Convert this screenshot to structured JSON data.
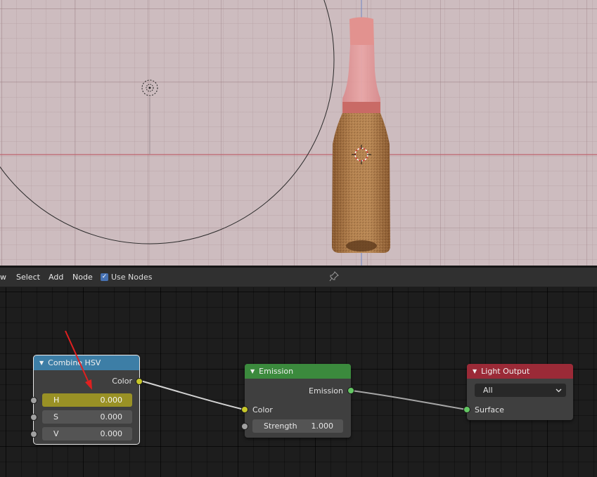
{
  "header": {
    "menu_fragment": "w",
    "menu_select": "Select",
    "menu_add": "Add",
    "menu_node": "Node",
    "use_nodes_label": "Use Nodes",
    "use_nodes_checked": true
  },
  "nodes": {
    "combine_hsv": {
      "title": "Combine HSV",
      "header_color": "#3d7ea6",
      "output_label": "Color",
      "inputs": [
        {
          "label": "H",
          "value": "0.000"
        },
        {
          "label": "S",
          "value": "0.000"
        },
        {
          "label": "V",
          "value": "0.000"
        }
      ]
    },
    "emission": {
      "title": "Emission",
      "header_color": "#3b8a3d",
      "output_label": "Emission",
      "input_color_label": "Color",
      "strength_label": "Strength",
      "strength_value": "1.000"
    },
    "light_output": {
      "title": "Light Output",
      "header_color": "#9b2a37",
      "target_value": "All",
      "input_label": "Surface"
    }
  },
  "colors": {
    "socket_color": "#c7c729",
    "socket_shader": "#63c763",
    "socket_value": "#a1a1a1",
    "annotation_arrow": "#e02020"
  },
  "icons": {
    "pin": "pin-icon",
    "checkbox": "checkmark-icon",
    "collapse": "triangle-down-icon",
    "dropdown": "chevron-down-icon"
  }
}
